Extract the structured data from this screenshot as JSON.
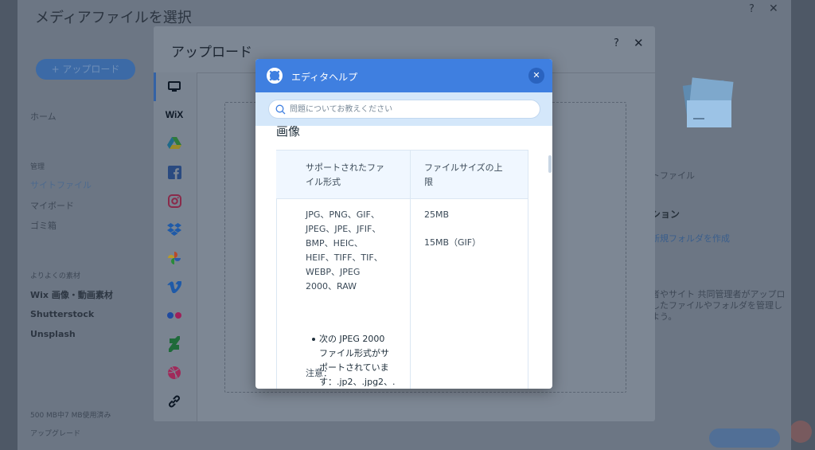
{
  "media_manager": {
    "title": "メディアファイルを選択",
    "help_label": "?",
    "close_label": "✕",
    "upload_button": "+ アップロード",
    "nav_home": "ホーム",
    "nav_section_label": "管理",
    "nav_site_files": "サイトファイル",
    "nav_my_board": "マイボード",
    "nav_trash": "ゴミ箱",
    "nav_frequent_label": "よりよくの素材",
    "nav_wix_media": "Wix 画像・動画素材",
    "nav_shutterstock": "Shutterstock",
    "nav_unsplash": "Unsplash",
    "storage_usage": "500 MB中7 MB使用済み",
    "upgrade_link": "アップグレード",
    "right_site_files": "トファイル",
    "right_section_heading": "ション",
    "right_create_folder": "新規フォルダを作成",
    "right_desc_1": "者やサイト 共同管理者がアップロ",
    "right_desc_2": "したファイルやフォルダを管理し",
    "right_desc_3": "よう。"
  },
  "upload_dialog": {
    "title": "アップロード",
    "help_label": "?",
    "close_label": "✕",
    "sources": [
      {
        "name": "my-computer"
      },
      {
        "name": "wix",
        "label": "WiX"
      },
      {
        "name": "google-drive"
      },
      {
        "name": "facebook"
      },
      {
        "name": "instagram"
      },
      {
        "name": "dropbox"
      },
      {
        "name": "google-photos"
      },
      {
        "name": "vimeo"
      },
      {
        "name": "flickr"
      },
      {
        "name": "deviantart"
      },
      {
        "name": "dribbble"
      },
      {
        "name": "link"
      }
    ]
  },
  "help_panel": {
    "title": "エディタヘルプ",
    "close_label": "✕",
    "search_placeholder": "問題についてお教えください",
    "section_title": "画像",
    "table": {
      "col1_header_line1": "サポートされたファ",
      "col1_header_line2": "イル形式",
      "col2_header_line1": "ファイルサイズの上",
      "col2_header_line2": "限",
      "formats_lines": [
        "JPG、PNG、GIF、",
        "JPEG、JPE、JFIF、",
        "BMP、HEIC、",
        "HEIF、TIFF、TIF、",
        "WEBP、JPEG",
        "2000、RAW"
      ],
      "size_main": "25MB",
      "size_gif": "15MB（GIF）",
      "note_title": "注意：",
      "note_lines": [
        "次の JPEG 2000",
        "ファイル形式がサ",
        "ポートされていま",
        "す：.jp2、.jpg2、."
      ]
    }
  },
  "colors": {
    "accent_blue": "#3f7fe0",
    "search_band": "#d4e7fa",
    "table_header": "#f0f7ff"
  }
}
